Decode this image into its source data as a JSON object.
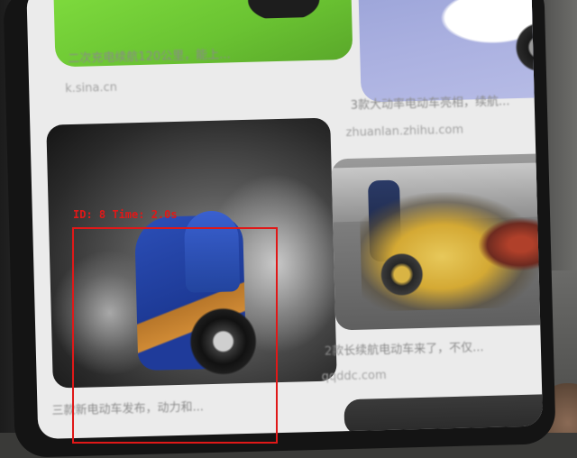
{
  "scene": {
    "description_colors": {
      "background": "#3a3a38",
      "phone": "#141414",
      "screen": "#ebebeb"
    }
  },
  "feed": {
    "cards": [
      {
        "caption": "二次充电续航120公里，能上...",
        "source": "k.sina.cn"
      },
      {
        "caption": "3款大动率电动车亮相，续航...",
        "source": "zhuanlan.zhihu.com"
      },
      {
        "caption": "三款新电动车发布，动力和...",
        "source": ""
      },
      {
        "caption": "2款长续航电动车来了，不仅...",
        "source": "qqddc.com"
      }
    ]
  },
  "detection": {
    "label": "ID: 8 Time: 2.0s",
    "color": "#e01818"
  }
}
